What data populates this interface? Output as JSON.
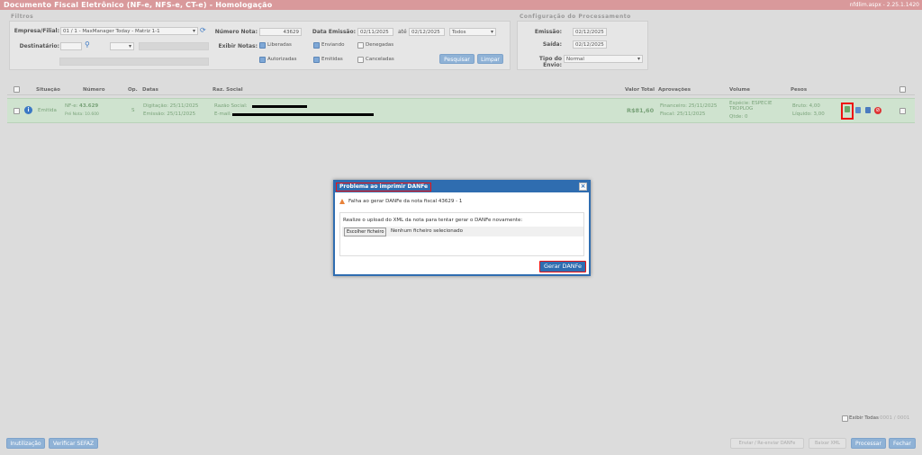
{
  "window": {
    "title": "Documento Fiscal Eletrônico (NF-e, NFS-e, CT-e) - Homologação",
    "version": "nfdlim.aspx - 2.25.1.1420"
  },
  "filters": {
    "section": "Filtros",
    "empresa_label": "Empresa/Filial:",
    "empresa_value": "01 / 1 - MaxManager Today - Matriz 1-1",
    "numero_nota_label": "Número Nota:",
    "numero_nota_value": "43629",
    "data_emissao_label": "Data Emissão:",
    "date_from": "02/11/2025",
    "ate_label": "até",
    "date_to": "02/12/2025",
    "todos_value": "Todos",
    "destinatario_label": "Destinatário:",
    "exibir_label": "Exibir Notas:",
    "liberadas": "Liberadas",
    "enviando": "Enviando",
    "denegadas": "Denegadas",
    "autorizadas": "Autorizadas",
    "emitidas": "Emitidas",
    "canceladas": "Canceladas",
    "pesquisar": "Pesquisar",
    "limpar": "Limpar"
  },
  "config": {
    "section": "Configuração do Processamento",
    "emissao_label": "Emissão:",
    "emissao_value": "02/12/2025",
    "saida_label": "Saída:",
    "saida_value": "02/12/2025",
    "tipo_envio_label": "Tipo do Envio:",
    "tipo_envio_value": "Normal"
  },
  "table": {
    "headers": {
      "situacao": "Situação",
      "numero": "Número",
      "op": "Op.",
      "datas": "Datas",
      "razao": "Raz. Social",
      "valor_total": "Valor Total",
      "aprovacoes": "Aprovações",
      "volume": "Volume",
      "pesos": "Pesos"
    },
    "row": {
      "situacao": "Emitida",
      "nfe_label": "NF-e:",
      "nfe_value": "43.629",
      "pre_nota": "Pré Nota: 10.600",
      "op": "S",
      "digitacao": "Digitação: 25/11/2025",
      "emissao": "Emissão: 25/11/2025",
      "razao_label": "Razão Social:",
      "email_label": "E-mail:",
      "valor": "R$81,60",
      "financeiro": "Financeiro: 25/11/2025",
      "fiscal": "Fiscal: 25/11/2025",
      "especie": "Espécie: ESPECIE TROPLOG",
      "qtde": "Qtde: 0",
      "bruto": "Bruto: 4,00",
      "liquido": "Líquido: 3,00"
    }
  },
  "modal": {
    "title": "Problema ao imprimir DANFe",
    "error": "Falha ao gerar DANFe da nota fiscal 43629 - 1",
    "instruction": "Realize o upload do XML da nota para tentar gerar o DANFe novamente:",
    "file_button": "Escolher ficheiro",
    "file_status": "Nenhum ficheiro selecionado",
    "submit": "Gerar DANFe",
    "close": "×"
  },
  "footer": {
    "exibir_todas": "Exibir Todas",
    "paging": "0001 / 0001",
    "inutilizacao": "Inutilização",
    "verificar_sefaz": "Verificar SEFAZ",
    "enviar_reenviar": "Enviar / Re-enviar DANFe",
    "baixar_xml": "Baixar XML",
    "processar": "Processar",
    "fechar": "Fechar"
  },
  "colors": {
    "titlebar": "#d9999b",
    "accent": "#2f6db0",
    "row_bg": "#cfe3cf",
    "highlight": "#e11111"
  }
}
